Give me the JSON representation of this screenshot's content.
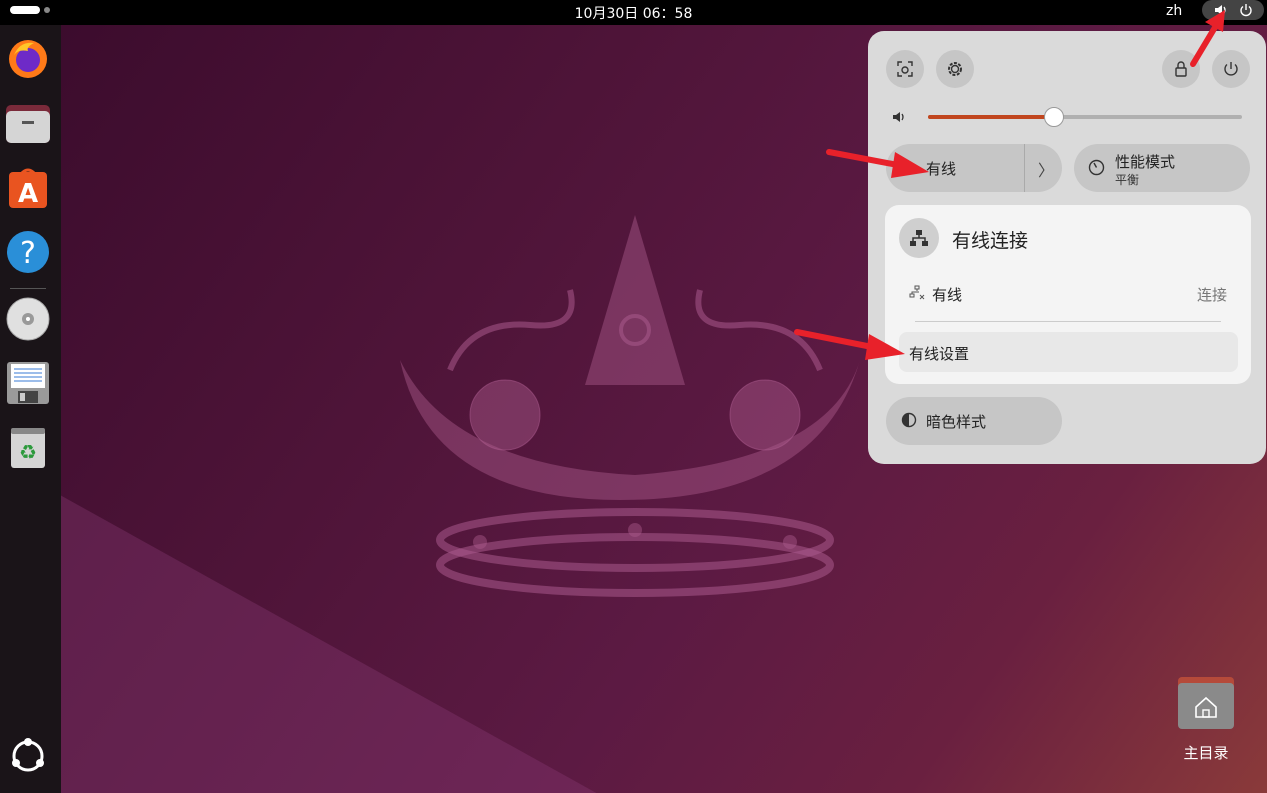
{
  "topbar": {
    "clock": "10月30日  06：58",
    "language": "zh"
  },
  "dock": {
    "items": [
      "firefox-icon",
      "files-icon",
      "app-center-icon",
      "help-icon",
      "cd-drive-icon",
      "floppy-drive-icon",
      "trash-icon",
      "show-apps-icon"
    ]
  },
  "quick_settings": {
    "volume_level": 0.4,
    "wired_label": "有线",
    "perf_title": "性能模式",
    "perf_subtitle": "平衡",
    "submenu": {
      "title": "有线连接",
      "row_label": "有线",
      "row_action": "连接",
      "settings_label": "有线设置"
    },
    "dark_label": "暗色样式"
  },
  "desktop": {
    "home_label": "主目录"
  },
  "colors": {
    "accent": "#c1461e",
    "annotation_arrow": "#e8212a"
  }
}
